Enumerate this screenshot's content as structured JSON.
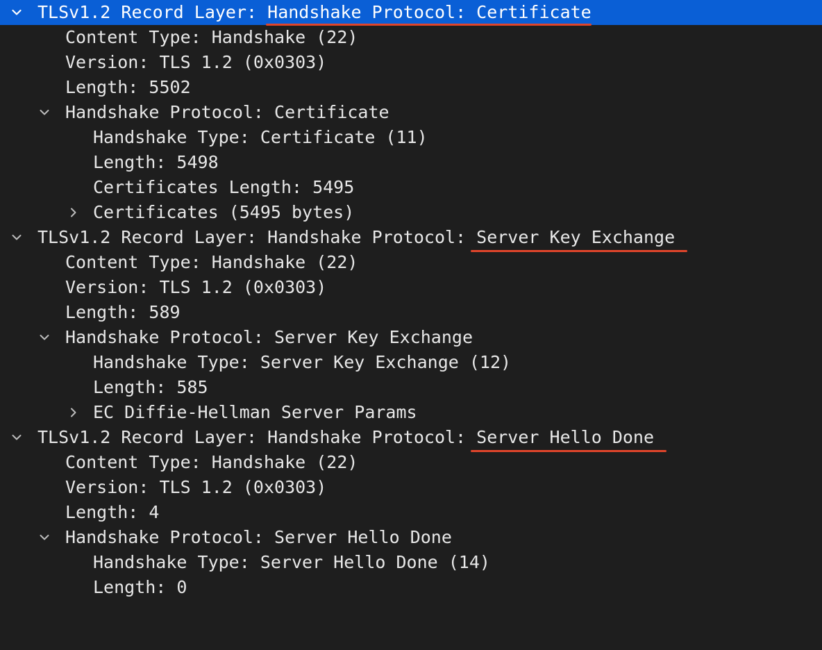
{
  "tree": {
    "records": [
      {
        "prefix": "TLSv1.2 Record Layer: ",
        "highlighted": "Handshake Protocol: Certificate",
        "content_type": "Content Type: Handshake (22)",
        "version": "Version: TLS 1.2 (0x0303)",
        "length": "Length: 5502",
        "handshake": {
          "label": "Handshake Protocol: Certificate",
          "type": "Handshake Type: Certificate (11)",
          "length": "Length: 5498",
          "cert_length": "Certificates Length: 5495",
          "child": "Certificates (5495 bytes)"
        }
      },
      {
        "prefix": "TLSv1.2 Record Layer: Handshake Protocol: ",
        "highlighted": "Server Key Exchange",
        "content_type": "Content Type: Handshake (22)",
        "version": "Version: TLS 1.2 (0x0303)",
        "length": "Length: 589",
        "handshake": {
          "label": "Handshake Protocol: Server Key Exchange",
          "type": "Handshake Type: Server Key Exchange (12)",
          "length": "Length: 585",
          "child": "EC Diffie-Hellman Server Params"
        }
      },
      {
        "prefix": "TLSv1.2 Record Layer: Handshake Protocol: ",
        "highlighted": "Server Hello Done",
        "content_type": "Content Type: Handshake (22)",
        "version": "Version: TLS 1.2 (0x0303)",
        "length": "Length: 4",
        "handshake": {
          "label": "Handshake Protocol: Server Hello Done",
          "type": "Handshake Type: Server Hello Done (14)",
          "length": "Length: 0"
        }
      }
    ]
  },
  "colors": {
    "background": "#1e1e1e",
    "text": "#e8e8e8",
    "selection": "#0a5fd6",
    "annotation_underline": "#e0452b"
  },
  "icons": {
    "expanded": "chevron-down-icon",
    "collapsed": "chevron-right-icon"
  }
}
